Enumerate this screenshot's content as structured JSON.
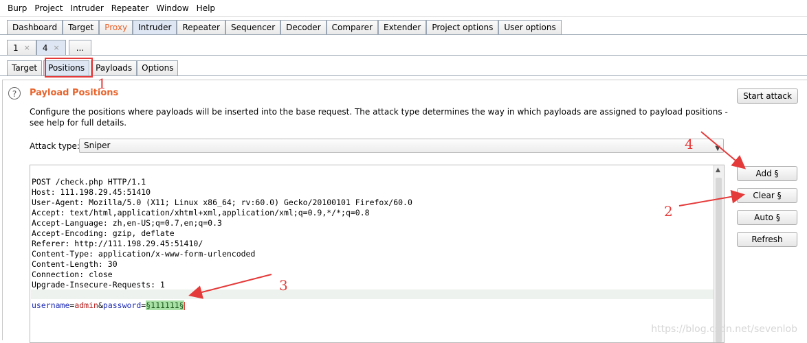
{
  "menu": [
    "Burp",
    "Project",
    "Intruder",
    "Repeater",
    "Window",
    "Help"
  ],
  "main_tabs": [
    "Dashboard",
    "Target",
    "Proxy",
    "Intruder",
    "Repeater",
    "Sequencer",
    "Decoder",
    "Comparer",
    "Extender",
    "Project options",
    "User options"
  ],
  "session_tabs": {
    "t1": "1",
    "t4": "4",
    "more": "...",
    "close": "×"
  },
  "sub_tabs": [
    "Target",
    "Positions",
    "Payloads",
    "Options"
  ],
  "help_glyph": "?",
  "section_title": "Payload Positions",
  "description": "Configure the positions where payloads will be inserted into the base request. The attack type determines the way in which payloads are assigned to payload positions - see help for full details.",
  "attack_type_label": "Attack type:",
  "attack_type_value": "Sniper",
  "buttons": {
    "start": "Start attack",
    "add": "Add §",
    "clear": "Clear §",
    "auto": "Auto §",
    "refresh": "Refresh"
  },
  "request_lines": [
    "POST /check.php HTTP/1.1",
    "Host: 111.198.29.45:51410",
    "User-Agent: Mozilla/5.0 (X11; Linux x86_64; rv:60.0) Gecko/20100101 Firefox/60.0",
    "Accept: text/html,application/xhtml+xml,application/xml;q=0.9,*/*;q=0.8",
    "Accept-Language: zh,en-US;q=0.7,en;q=0.3",
    "Accept-Encoding: gzip, deflate",
    "Referer: http://111.198.29.45:51410/",
    "Content-Type: application/x-www-form-urlencoded",
    "Content-Length: 30",
    "Connection: close",
    "Upgrade-Insecure-Requests: 1"
  ],
  "body": {
    "k1": "username",
    "eq1": "=",
    "v1": "admin",
    "amp": "&",
    "k2": "password",
    "eq2": "=",
    "v2": "§111111§"
  },
  "annotations": {
    "a1": "1",
    "a2": "2",
    "a3": "3",
    "a4": "4"
  },
  "watermark": "https://blog.csdn.net/sevenlob",
  "colors": {
    "accent": "#e8632b",
    "annotation": "#e53a3a"
  }
}
